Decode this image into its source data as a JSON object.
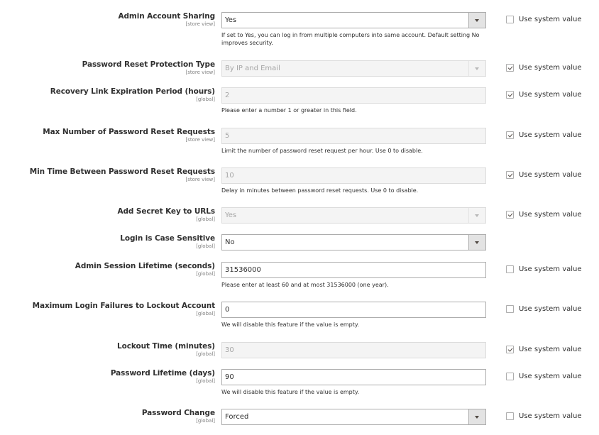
{
  "use_system_value_label": "Use system value",
  "fields": [
    {
      "label": "Admin Account Sharing",
      "scope": "[store view]",
      "type": "select",
      "value": "Yes",
      "disabled": false,
      "note": "If set to Yes, you can log in from multiple computers into same account. Default setting No improves security.",
      "use_system_value": false
    },
    {
      "label": "Password Reset Protection Type",
      "scope": "[store view]",
      "type": "select",
      "value": "By IP and Email",
      "disabled": true,
      "note": "",
      "use_system_value": true
    },
    {
      "label": "Recovery Link Expiration Period (hours)",
      "scope": "[global]",
      "type": "text",
      "value": "2",
      "disabled": true,
      "note": "Please enter a number 1 or greater in this field.",
      "use_system_value": true
    },
    {
      "label": "Max Number of Password Reset Requests",
      "scope": "[store view]",
      "type": "text",
      "value": "5",
      "disabled": true,
      "note": "Limit the number of password reset request per hour. Use 0 to disable.",
      "use_system_value": true
    },
    {
      "label": "Min Time Between Password Reset Requests",
      "scope": "[store view]",
      "type": "text",
      "value": "10",
      "disabled": true,
      "note": "Delay in minutes between password reset requests. Use 0 to disable.",
      "use_system_value": true
    },
    {
      "label": "Add Secret Key to URLs",
      "scope": "[global]",
      "type": "select",
      "value": "Yes",
      "disabled": true,
      "note": "",
      "use_system_value": true
    },
    {
      "label": "Login is Case Sensitive",
      "scope": "[global]",
      "type": "select",
      "value": "No",
      "disabled": false,
      "note": "",
      "use_system_value": null
    },
    {
      "label": "Admin Session Lifetime (seconds)",
      "scope": "[global]",
      "type": "text",
      "value": "31536000",
      "disabled": false,
      "note": "Please enter at least 60 and at most 31536000 (one year).",
      "use_system_value": false
    },
    {
      "label": "Maximum Login Failures to Lockout Account",
      "scope": "[global]",
      "type": "text",
      "value": "0",
      "disabled": false,
      "note": "We will disable this feature if the value is empty.",
      "use_system_value": false
    },
    {
      "label": "Lockout Time (minutes)",
      "scope": "[global]",
      "type": "text",
      "value": "30",
      "disabled": true,
      "note": "",
      "use_system_value": true
    },
    {
      "label": "Password Lifetime (days)",
      "scope": "[global]",
      "type": "text",
      "value": "90",
      "disabled": false,
      "note": "We will disable this feature if the value is empty.",
      "use_system_value": false
    },
    {
      "label": "Password Change",
      "scope": "[global]",
      "type": "select",
      "value": "Forced",
      "disabled": false,
      "note": "",
      "use_system_value": false
    }
  ]
}
